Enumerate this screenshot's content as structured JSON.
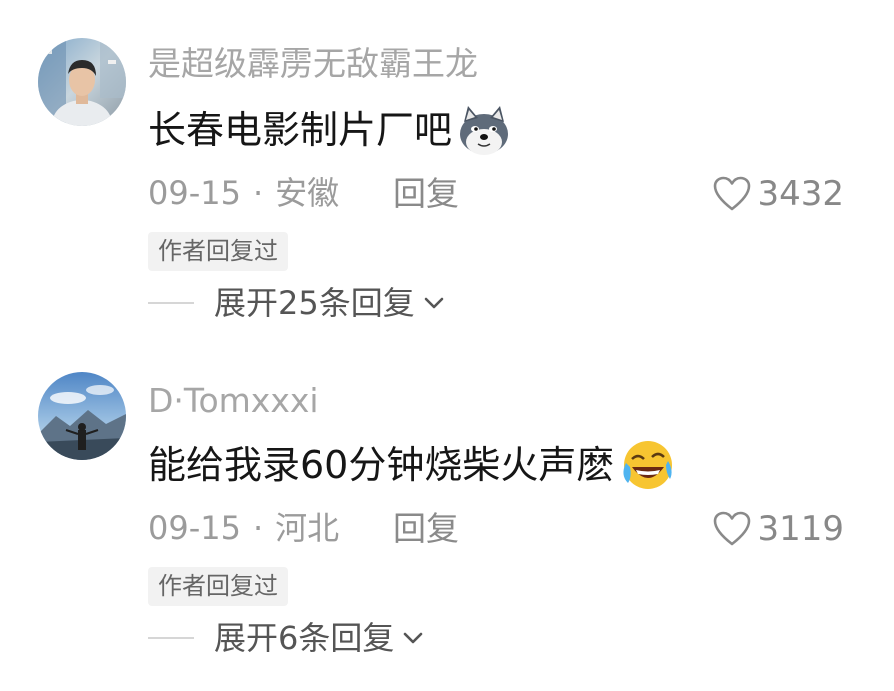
{
  "comments": [
    {
      "username": "是超级霹雳无敌霸王龙",
      "text": "长春电影制片厂吧",
      "emoji": "doge-emoji",
      "date": "09-15",
      "dot": "·",
      "location": "安徽",
      "reply_label": "回复",
      "likes": "3432",
      "author_badge": "作者回复过",
      "expand_label": "展开25条回复"
    },
    {
      "username": "D·Tomxxxi",
      "text": "能给我录60分钟烧柴火声麽",
      "emoji": "laughing-crying-emoji",
      "date": "09-15",
      "dot": "·",
      "location": "河北",
      "reply_label": "回复",
      "likes": "3119",
      "author_badge": "作者回复过",
      "expand_label": "展开6条回复"
    }
  ],
  "colors": {
    "username": "#a6a6a6",
    "content": "#161616",
    "meta": "#9b9b9b",
    "badge_bg": "#f2f2f2"
  }
}
